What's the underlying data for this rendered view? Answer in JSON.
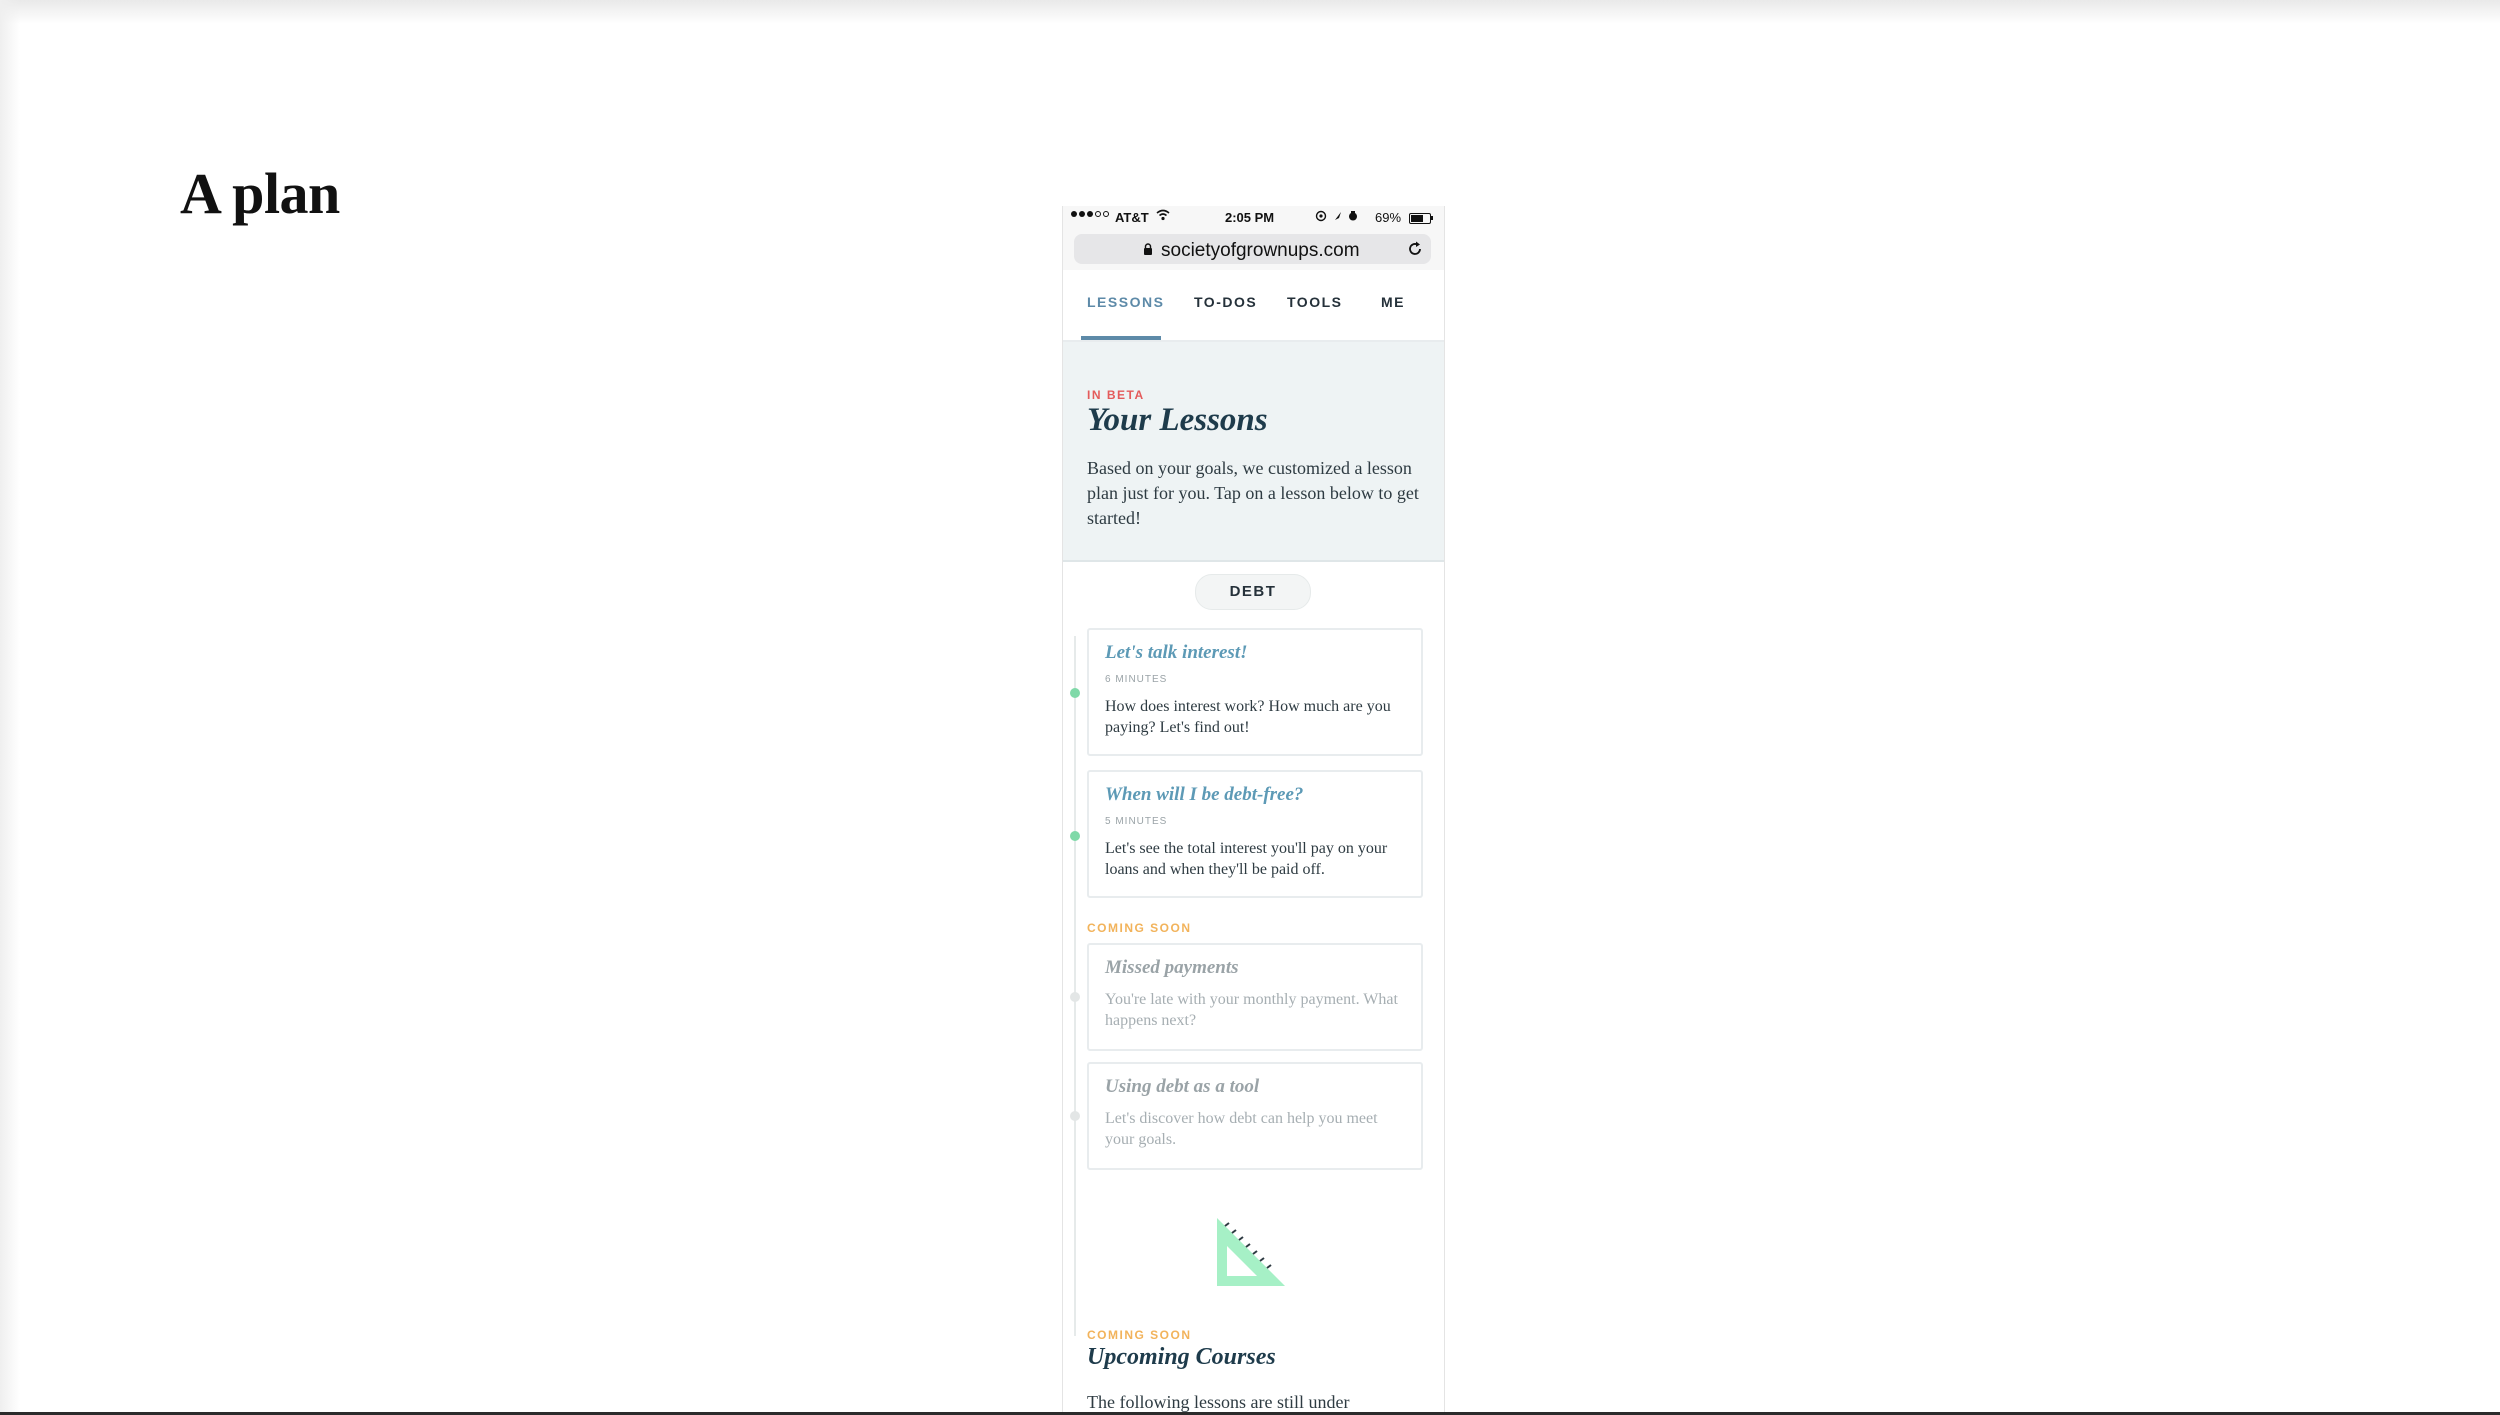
{
  "slide": {
    "title": "A plan"
  },
  "status_bar": {
    "carrier": "AT&T",
    "time": "2:05 PM",
    "battery_text": "69%",
    "battery_level": 0.69,
    "signal_bars": 3
  },
  "browser": {
    "url": "societyofgrownups.com"
  },
  "tabs": [
    {
      "label": "LESSONS",
      "active": true
    },
    {
      "label": "TO-DOS",
      "active": false
    },
    {
      "label": "TOOLS",
      "active": false
    },
    {
      "label": "ME",
      "active": false
    }
  ],
  "hero": {
    "badge": "IN BETA",
    "title": "Your Lessons",
    "text": "Based on your goals, we customized a lesson plan just for you. Tap on a lesson below to get started!"
  },
  "category": {
    "label": "DEBT"
  },
  "lessons": [
    {
      "title": "Let's talk interest!",
      "duration": "6 MINUTES",
      "desc": "How does interest work? How much are you paying? Let's find out!"
    },
    {
      "title": "When will I be debt-free?",
      "duration": "5 MINUTES",
      "desc": "Let's see the total interest you'll pay on your loans and when they'll be paid off."
    }
  ],
  "coming_soon": {
    "label": "COMING SOON",
    "lessons": [
      {
        "title": "Missed payments",
        "desc": "You're late with your monthly payment. What happens next?"
      },
      {
        "title": "Using debt as a tool",
        "desc": "Let's discover how debt can help you meet your goals."
      }
    ]
  },
  "upcoming": {
    "label": "COMING SOON",
    "title": "Upcoming Courses",
    "text": "The following lessons are still under"
  },
  "colors": {
    "accent": "#5d8aa8",
    "beta": "#e45b5b",
    "coming_soon": "#f2b35b",
    "timeline_done": "#7fd9a8",
    "icon_green": "#a6f0c6"
  },
  "icons": [
    "lock-icon",
    "reload-icon",
    "wifi-icon",
    "set-square-icon"
  ]
}
